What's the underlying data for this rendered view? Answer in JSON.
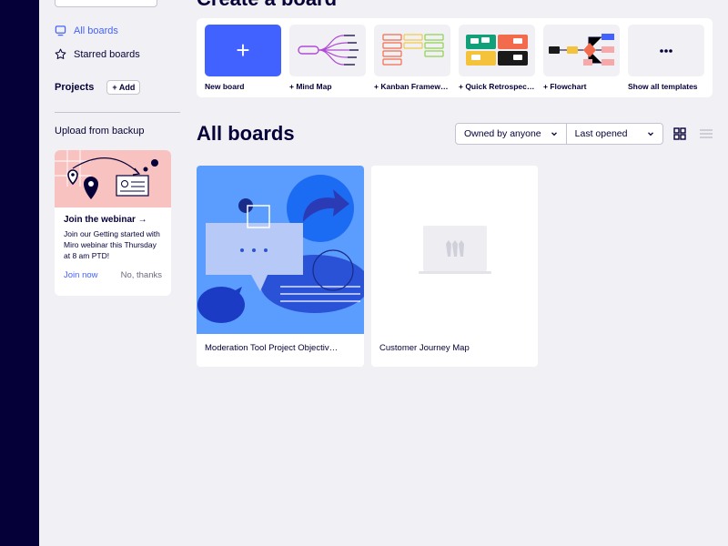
{
  "sidebar": {
    "nav": [
      {
        "label": "All boards",
        "icon": "boards-icon",
        "active": true
      },
      {
        "label": "Starred boards",
        "icon": "star-icon",
        "active": false
      }
    ],
    "projects_title": "Projects",
    "add_label": "+ Add",
    "upload_label": "Upload from backup",
    "webinar": {
      "title": "Join the webinar →",
      "text": "Join our Getting started with Miro webinar this Thursday at 8 am PTD!",
      "join_label": "Join now",
      "dismiss_label": "No, thanks"
    }
  },
  "main": {
    "create_title": "Create a board",
    "templates": [
      {
        "label": "New board"
      },
      {
        "label": "+ Mind Map"
      },
      {
        "label": "+ Kanban Framew…"
      },
      {
        "label": "+ Quick Retrospec…"
      },
      {
        "label": "+ Flowchart"
      },
      {
        "label": "Show all templates"
      }
    ],
    "all_boards_title": "All boards",
    "filters": {
      "owner": "Owned by anyone",
      "sort": "Last opened"
    },
    "boards": [
      {
        "name": "Moderation Tool Project Objectiv…"
      },
      {
        "name": "Customer Journey Map"
      }
    ]
  },
  "colors": {
    "accent": "#4262ff",
    "rail": "#050038",
    "webinar_art": "#f7c2c0",
    "board_thumb_blue": "#5b9dff"
  }
}
